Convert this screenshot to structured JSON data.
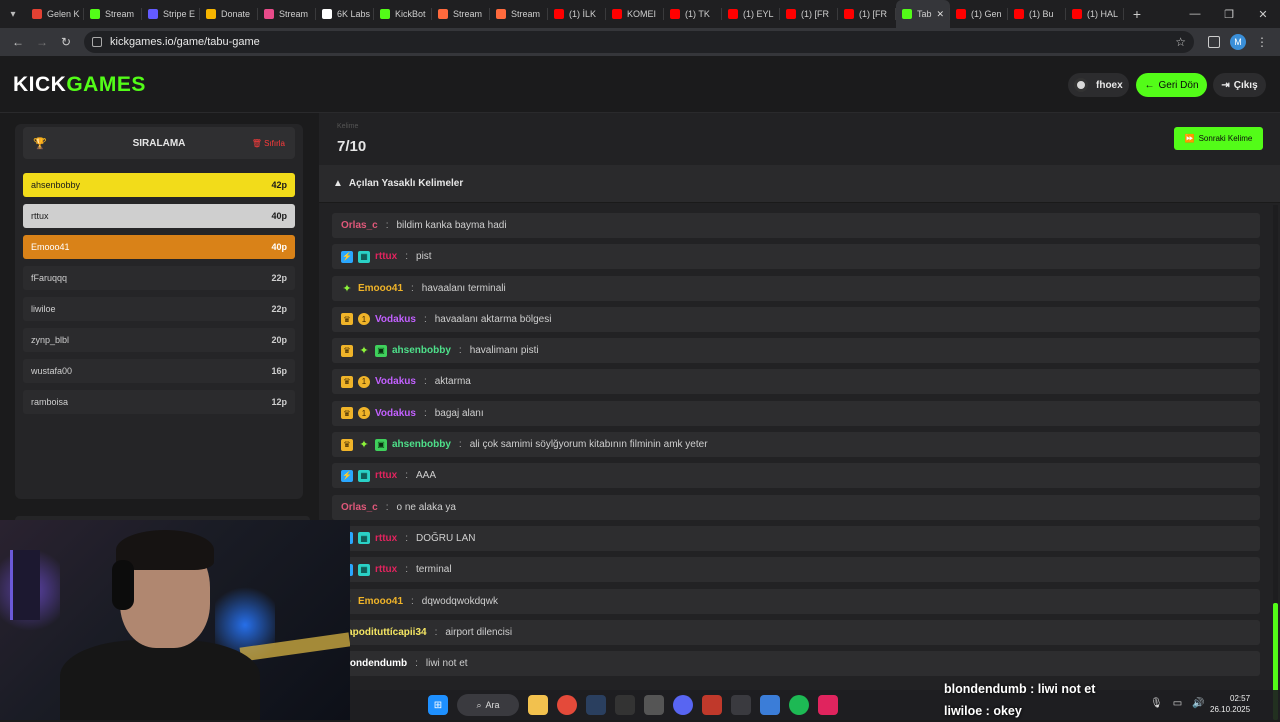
{
  "browser": {
    "tabs": [
      {
        "label": "Gelen K",
        "color": "#e34133"
      },
      {
        "label": "Stream",
        "color": "#53fc18"
      },
      {
        "label": "Stripe E",
        "color": "#635bff"
      },
      {
        "label": "Donate",
        "color": "#f5b400"
      },
      {
        "label": "Stream",
        "color": "#e84b8a"
      },
      {
        "label": "6K Labs",
        "color": "#ffffff"
      },
      {
        "label": "KickBot",
        "color": "#53fc18"
      },
      {
        "label": "Stream",
        "color": "#ff6a3d"
      },
      {
        "label": "Stream",
        "color": "#ff6a3d"
      },
      {
        "label": "(1) İLK",
        "color": "#ff0000"
      },
      {
        "label": "KOMEI",
        "color": "#ff0000"
      },
      {
        "label": "(1) TK",
        "color": "#ff0000"
      },
      {
        "label": "(1) EYL",
        "color": "#ff0000"
      },
      {
        "label": "(1) [FR",
        "color": "#ff0000"
      },
      {
        "label": "(1) [FR",
        "color": "#ff0000"
      }
    ],
    "active_tab": {
      "label": "Tab",
      "color": "#53fc18"
    },
    "tabs_after": [
      {
        "label": "(1) Gen",
        "color": "#ff0000"
      },
      {
        "label": "(1) Bu",
        "color": "#ff0000"
      },
      {
        "label": "(1) HAL",
        "color": "#ff0000"
      }
    ],
    "url": "kickgames.io/game/tabu-game",
    "profile_initial": "M"
  },
  "header": {
    "logo_part1": "KICK",
    "logo_part2": "GAMES",
    "username": "fhoex",
    "back_label": "Geri Dön",
    "logout_label": "Çıkış"
  },
  "leaderboard": {
    "title": "SIRALAMA",
    "reset_label": "Sıfırla",
    "rows": [
      {
        "name": "ahsenbobby",
        "points": "42p"
      },
      {
        "name": "rttux",
        "points": "40p"
      },
      {
        "name": "Emooo41",
        "points": "40p"
      },
      {
        "name": "fFaruqqq",
        "points": "22p"
      },
      {
        "name": "liwiloe",
        "points": "22p"
      },
      {
        "name": "zynp_blbl",
        "points": "20p"
      },
      {
        "name": "wustafa00",
        "points": "16p"
      },
      {
        "name": "ramboisa",
        "points": "12p"
      }
    ]
  },
  "game": {
    "round_label": "Kelime",
    "round_value": "7/10",
    "next_label": "Sonraki Kelime",
    "banned_title": "Açılan Yasaklı Kelimeler"
  },
  "chat": [
    {
      "user": "Orlas_c",
      "color": "#e0587a",
      "badges": [],
      "text": "bildim kanka bayma hadi"
    },
    {
      "user": "rttux",
      "color": "#e0245e",
      "badges": [
        "blue",
        "cyan"
      ],
      "text": "pist"
    },
    {
      "user": "Emooo41",
      "color": "#f0b429",
      "badges": [
        "spark"
      ],
      "text": "havaalanı terminali"
    },
    {
      "user": "Vodakus",
      "color": "#c260ff",
      "badges": [
        "crown",
        "coin"
      ],
      "text": "havaalanı aktarma bölgesi"
    },
    {
      "user": "ahsenbobby",
      "color": "#4ee08a",
      "badges": [
        "crown",
        "spark",
        "gift"
      ],
      "text": "havalimanı pisti"
    },
    {
      "user": "Vodakus",
      "color": "#c260ff",
      "badges": [
        "crown",
        "coin"
      ],
      "text": "aktarma"
    },
    {
      "user": "Vodakus",
      "color": "#c260ff",
      "badges": [
        "crown",
        "coin"
      ],
      "text": "bagaj alanı"
    },
    {
      "user": "ahsenbobby",
      "color": "#4ee08a",
      "badges": [
        "crown",
        "spark",
        "gift"
      ],
      "text": "ali çok samimi söylğyorum kitabının filminin amk yeter"
    },
    {
      "user": "rttux",
      "color": "#e0245e",
      "badges": [
        "blue",
        "cyan"
      ],
      "text": "AAA"
    },
    {
      "user": "Orlas_c",
      "color": "#e0587a",
      "badges": [],
      "text": "o ne alaka ya"
    },
    {
      "user": "rttux",
      "color": "#e0245e",
      "badges": [
        "blue",
        "cyan"
      ],
      "text": "DOĞRU LAN"
    },
    {
      "user": "rttux",
      "color": "#e0245e",
      "badges": [
        "blue",
        "cyan"
      ],
      "text": "terminal"
    },
    {
      "user": "Emooo41",
      "color": "#f0b429",
      "badges": [
        "spark"
      ],
      "text": "dqwodqwokdqwk"
    },
    {
      "user": "papodituttícapii34",
      "color": "#f5e663",
      "badges": [],
      "text": "airport dilencisi"
    },
    {
      "user": "blondendumb",
      "color": "#ffffff",
      "badges": [],
      "text": "liwi not et"
    }
  ],
  "overlay_chat": [
    {
      "user": "blondendumb",
      "text": "liwi not et"
    },
    {
      "user": "liwiloe",
      "text": "okey"
    }
  ],
  "taskbar": {
    "search_label": "Ara",
    "time": "02:57",
    "date": "26.10.2025"
  }
}
